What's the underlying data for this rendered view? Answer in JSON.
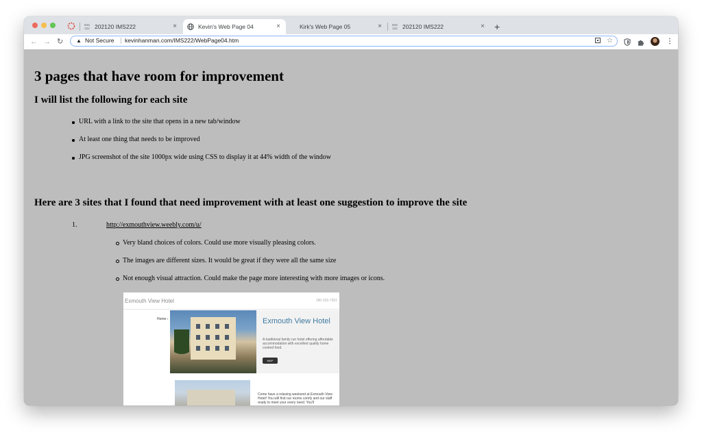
{
  "browser": {
    "tabs": [
      {
        "favicon": "ims-222-icon",
        "favicon_text": "IMS\n222",
        "title": "202120 IMS222",
        "active": false
      },
      {
        "favicon": "globe-icon",
        "title": "Kevin's Web Page 04",
        "active": true
      },
      {
        "favicon": "none",
        "title": "Kirk's Web Page 05",
        "active": false
      },
      {
        "favicon": "ims-222-icon",
        "favicon_text": "IMS\n222",
        "title": "202120 IMS222",
        "active": false
      }
    ],
    "close_glyph": "×",
    "new_tab_glyph": "+",
    "back_glyph": "←",
    "forward_glyph": "→",
    "reload_glyph": "↻",
    "omnibox": {
      "warning_glyph": "▲",
      "security_label": "Not Secure",
      "url": "kevinhanman.com/IMS222/WebPage04.htm"
    },
    "colors": {
      "accent": "#8ab4f8",
      "tabstrip": "#dee1e6",
      "page_bg": "#bdbdbd"
    }
  },
  "page": {
    "heading": "3 pages that have room for improvement",
    "subheading": "I will list the following for each site",
    "requirements": [
      "URL with a link to the site that opens in a new tab/window",
      "At least one thing that needs to be improved",
      "JPG screenshot of the site 1000px wide using CSS to display it at 44% width of the window"
    ],
    "sites_heading": "Here are 3 sites that I found that need improvement with at least one suggestion to improve the site",
    "sites": [
      {
        "number": "1.",
        "url": "http://exmouthview.weebly.com/u/",
        "suggestions": [
          "Very bland choices of colors. Could use more visually pleasing colors.",
          "The images are different sizes. It would be great if they were all the same size",
          "Not enough visual attraction. Could make the page more interesting with more images or icons."
        ],
        "screenshot": {
          "site_title": "Exmouth View Hotel",
          "phone": "180-333-7301",
          "nav_item": "Home ›",
          "hotel_name": "Exmouth View Hotel",
          "description": "A traditional family run hotel offering affordable accommodation with excellent quality home cooked food.",
          "button_label": "MAP",
          "body_text": "Come have a relaxing weekend at Exmouth View Hotel! You will find our rooms comfy and our staff ready to meet your every need. You'll"
        }
      }
    ]
  }
}
